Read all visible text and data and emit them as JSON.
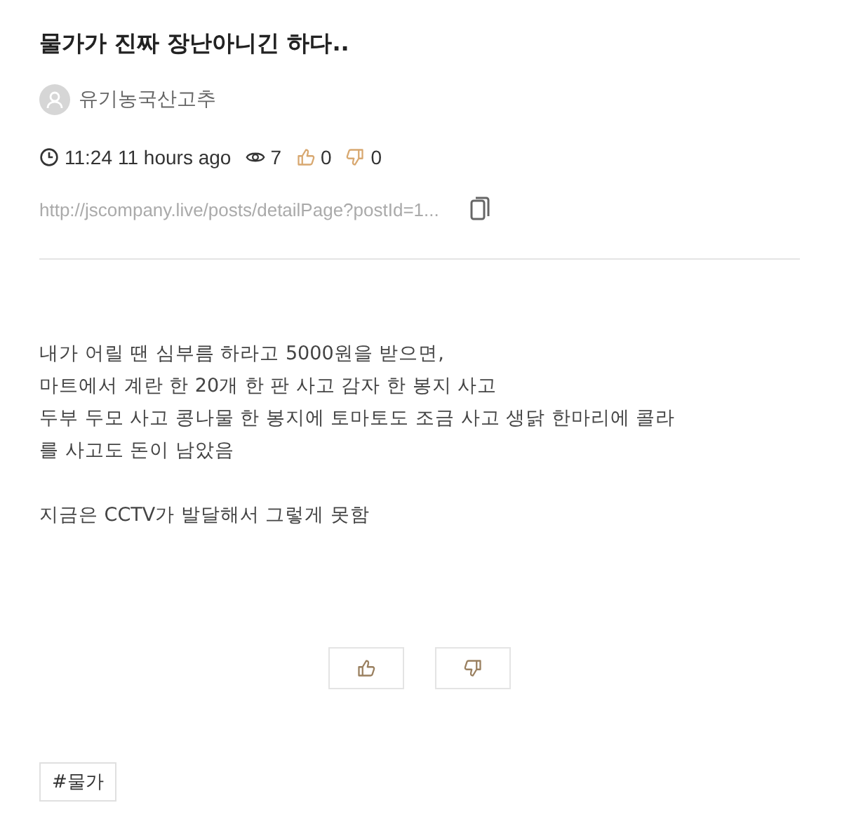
{
  "post": {
    "title": "물가가 진짜 장난아니긴 하다..",
    "author": "유기농국산고추",
    "meta": {
      "time": "11:24",
      "ago": "11 hours ago",
      "views": "7",
      "likes": "0",
      "dislikes": "0"
    },
    "url": "http://jscompany.live/posts/detailPage?postId=1...",
    "paragraphs": [
      [
        "내가 어릴 땐 심부름 하라고 5000원을 받으면,",
        "마트에서 계란 한 20개 한 판 사고 감자 한 봉지 사고",
        "두부 두모 사고 콩나물 한 봉지에 토마토도 조금 사고 생닭 한마리에 콜라",
        "를 사고도 돈이 남았음"
      ],
      [
        "지금은 CCTV가 발달해서 그렇게 못함"
      ]
    ],
    "tags": [
      "#물가"
    ]
  }
}
